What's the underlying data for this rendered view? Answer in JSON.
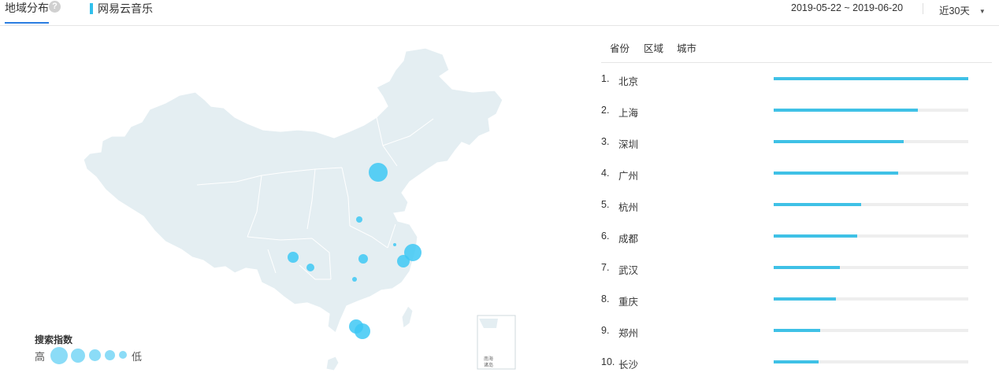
{
  "header": {
    "tab_label": "地域分布",
    "help_label": "?",
    "brand": "网易云音乐",
    "date_range": "2019-05-22 ~ 2019-06-20",
    "range_select": "近30天"
  },
  "map": {
    "inset_label_1": "南海",
    "inset_label_2": "诸岛",
    "legend": {
      "title": "搜索指数",
      "high": "高",
      "low": "低"
    }
  },
  "ranking": {
    "tabs": [
      "省份",
      "区域",
      "城市"
    ],
    "items": [
      {
        "rank": "1.",
        "name": "北京",
        "value": 1.0
      },
      {
        "rank": "2.",
        "name": "上海",
        "value": 0.74
      },
      {
        "rank": "3.",
        "name": "深圳",
        "value": 0.67
      },
      {
        "rank": "4.",
        "name": "广州",
        "value": 0.64
      },
      {
        "rank": "5.",
        "name": "杭州",
        "value": 0.45
      },
      {
        "rank": "6.",
        "name": "成都",
        "value": 0.43
      },
      {
        "rank": "7.",
        "name": "武汉",
        "value": 0.34
      },
      {
        "rank": "8.",
        "name": "重庆",
        "value": 0.32
      },
      {
        "rank": "9.",
        "name": "郑州",
        "value": 0.24
      },
      {
        "rank": "10.",
        "name": "长沙",
        "value": 0.23
      }
    ]
  },
  "colors": {
    "accent": "#2a7de1",
    "bar": "#3fc1e6",
    "map_fill": "#e4eef2",
    "bubble": "#3ec8f5"
  }
}
